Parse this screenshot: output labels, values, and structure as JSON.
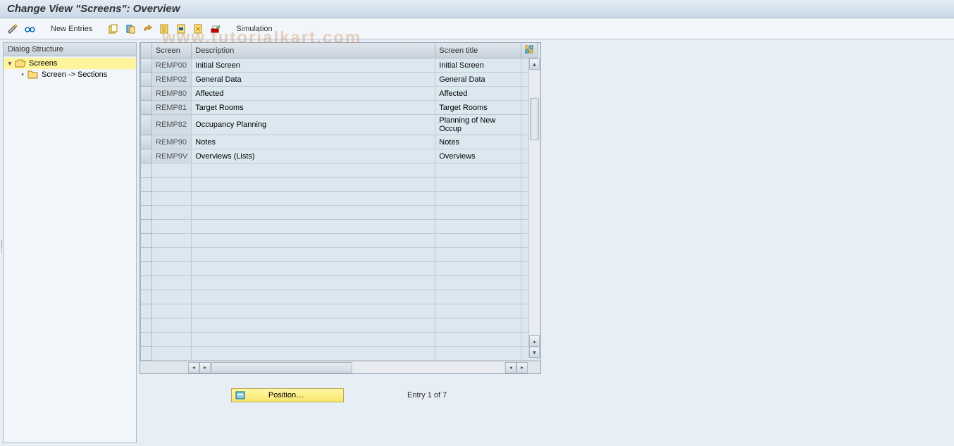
{
  "title": "Change View \"Screens\": Overview",
  "toolbar": {
    "new_entries": "New Entries",
    "simulation": "Simulation"
  },
  "dialog_structure": {
    "header": "Dialog Structure",
    "items": [
      {
        "label": "Screens",
        "level": 0,
        "expanded": true,
        "selected": true,
        "icon": "folder-open"
      },
      {
        "label": "Screen -> Sections",
        "level": 1,
        "expanded": false,
        "selected": false,
        "icon": "folder"
      }
    ]
  },
  "table": {
    "columns": [
      "Screen",
      "Description",
      "Screen title"
    ],
    "rows": [
      {
        "screen": "REMP00",
        "description": "Initial Screen",
        "title": "Initial Screen"
      },
      {
        "screen": "REMP02",
        "description": "General Data",
        "title": "General Data"
      },
      {
        "screen": "REMP80",
        "description": "Affected",
        "title": "Affected"
      },
      {
        "screen": "REMP81",
        "description": "Target Rooms",
        "title": "Target Rooms"
      },
      {
        "screen": "REMP82",
        "description": "Occupancy Planning",
        "title": "Planning of New Occup"
      },
      {
        "screen": "REMP90",
        "description": "Notes",
        "title": "Notes"
      },
      {
        "screen": "REMP9V",
        "description": "Overviews (Lists)",
        "title": "Overviews"
      }
    ],
    "empty_rows": 14
  },
  "footer": {
    "position_btn": "Position…",
    "entry_text": "Entry 1 of 7"
  },
  "watermark": "www.tutorialkart.com"
}
